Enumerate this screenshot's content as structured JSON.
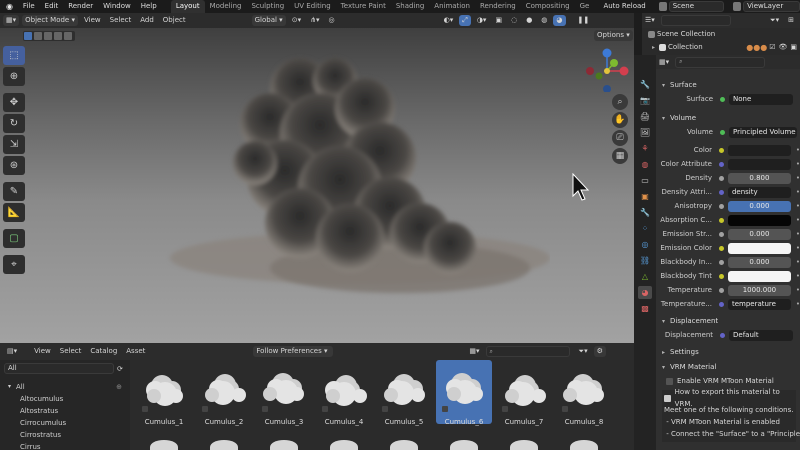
{
  "menubar": {
    "menus": [
      "File",
      "Edit",
      "Render",
      "Window",
      "Help"
    ],
    "workspaces": [
      "Layout",
      "Modeling",
      "Sculpting",
      "UV Editing",
      "Texture Paint",
      "Shading",
      "Animation",
      "Rendering",
      "Compositing",
      "Ge"
    ],
    "active_workspace": "Layout",
    "auto_reload": "Auto Reload",
    "scene": "Scene",
    "view_layer": "ViewLayer"
  },
  "viewport_header": {
    "mode": "Object Mode",
    "menus": [
      "View",
      "Select",
      "Add",
      "Object"
    ],
    "transform_orientation": "Global",
    "options": "Options"
  },
  "outliner": {
    "scene_collection": "Scene Collection",
    "collection": "Collection"
  },
  "properties": {
    "surface_section": "Surface",
    "surface_label": "Surface",
    "surface_value": "None",
    "volume_section": "Volume",
    "volume_label": "Volume",
    "volume_value": "Principled Volume",
    "rows": [
      {
        "label": "Color",
        "value": "",
        "style": "dark",
        "dot": "#c7c729"
      },
      {
        "label": "Color Attribute",
        "value": "",
        "style": "dark",
        "dot": "#6363c7"
      },
      {
        "label": "Density",
        "value": "0.800",
        "style": "num",
        "dot": "#a1a1a1"
      },
      {
        "label": "Density Attri...",
        "value": "density",
        "style": "text",
        "dot": "#6363c7"
      },
      {
        "label": "Anisotropy",
        "value": "0.000",
        "style": "blue",
        "dot": "#a1a1a1"
      },
      {
        "label": "Absorption C...",
        "value": "",
        "style": "black",
        "dot": "#c7c729"
      },
      {
        "label": "Emission Str...",
        "value": "0.000",
        "style": "num",
        "dot": "#a1a1a1"
      },
      {
        "label": "Emission Color",
        "value": "",
        "style": "white",
        "dot": "#c7c729"
      },
      {
        "label": "Blackbody In...",
        "value": "0.000",
        "style": "num",
        "dot": "#a1a1a1"
      },
      {
        "label": "Blackbody Tint",
        "value": "",
        "style": "white",
        "dot": "#c7c729"
      },
      {
        "label": "Temperature",
        "value": "1000.000",
        "style": "num",
        "dot": "#a1a1a1"
      },
      {
        "label": "Temperature...",
        "value": "temperature",
        "style": "text",
        "dot": "#6363c7"
      }
    ],
    "displacement_section": "Displacement",
    "displacement_label": "Displacement",
    "displacement_value": "Default",
    "settings_section": "Settings",
    "vrm_section": "VRM Material",
    "vrm_checkbox": "Enable VRM MToon Material",
    "vrm_info": [
      "How to export this material to VRM.",
      "Meet one of the following conditions.",
      " - VRM MToon Material is enabled",
      " - Connect the \"Surface\" to a \"Principled..."
    ]
  },
  "asset_browser": {
    "menus": [
      "View",
      "Select",
      "Catalog",
      "Asset"
    ],
    "import_method": "Follow Preferences",
    "library": "All",
    "catalog_root": "All",
    "catalogs": [
      "Altocumulus",
      "Altostratus",
      "Cirrocumulus",
      "Cirrostratus",
      "Cirrus"
    ],
    "assets": [
      "Cumulus_1",
      "Cumulus_2",
      "Cumulus_3",
      "Cumulus_4",
      "Cumulus_5",
      "Cumulus_6",
      "Cumulus_7",
      "Cumulus_8"
    ],
    "selected_asset": "Cumulus_6"
  }
}
